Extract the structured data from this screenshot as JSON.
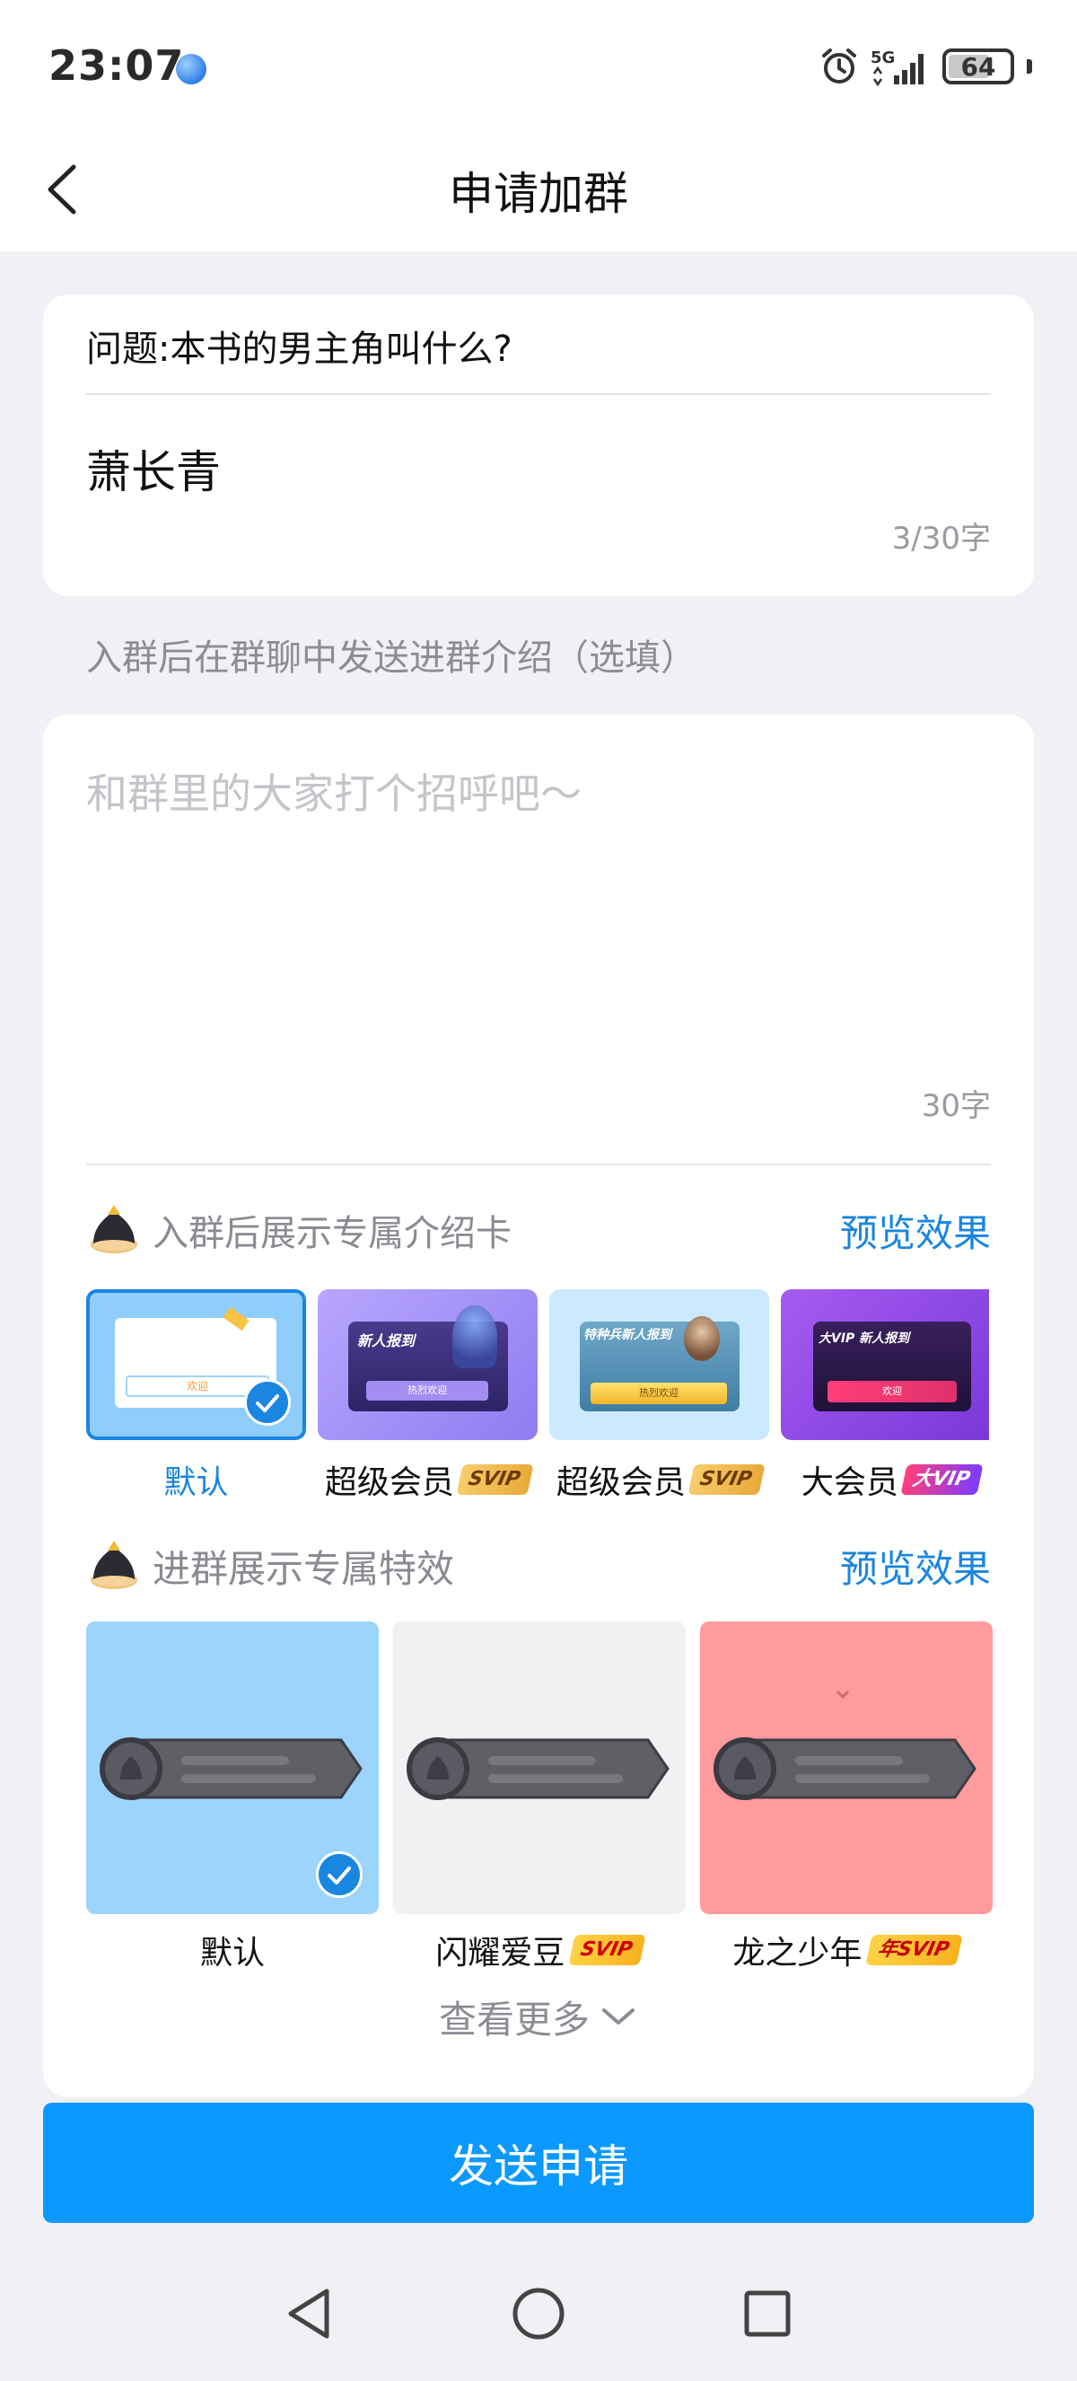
{
  "status_bar": {
    "time": "23:07",
    "network": "5G",
    "battery": "64"
  },
  "header": {
    "title": "申请加群"
  },
  "question": {
    "text": "问题:本书的男主角叫什么?",
    "answer": "萧长青",
    "count": "3/30字"
  },
  "intro": {
    "label": "入群后在群聊中发送进群介绍（选填）",
    "placeholder": "和群里的大家打个招呼吧～",
    "count": "30字"
  },
  "intro_card_section": {
    "title": "入群后展示专属介绍卡",
    "preview": "预览效果",
    "options": [
      {
        "label": "默认",
        "badge": "",
        "selected": true
      },
      {
        "label": "超级会员",
        "badge": "SVIP",
        "selected": false
      },
      {
        "label": "超级会员",
        "badge": "SVIP",
        "selected": false
      },
      {
        "label": "大会员",
        "badge": "大VIP",
        "selected": false
      }
    ],
    "thumb_texts": {
      "welcome": "欢迎",
      "new_report": "新人报到",
      "hot_welcome": "热烈欢迎",
      "special_report": "特种兵新人报到",
      "vip_report": "大VIP 新人报到"
    }
  },
  "effect_section": {
    "title": "进群展示专属特效",
    "preview": "预览效果",
    "options": [
      {
        "label": "默认",
        "badge": "",
        "selected": true
      },
      {
        "label": "闪耀爱豆",
        "badge": "SVIP",
        "selected": false
      },
      {
        "label": "龙之少年",
        "badge": "年SVIP",
        "selected": false
      }
    ]
  },
  "view_more": "查看更多",
  "submit": "发送申请",
  "colors": {
    "accent": "#1a86e0",
    "button": "#0b99ff",
    "page_bg": "#f0f0f5"
  }
}
